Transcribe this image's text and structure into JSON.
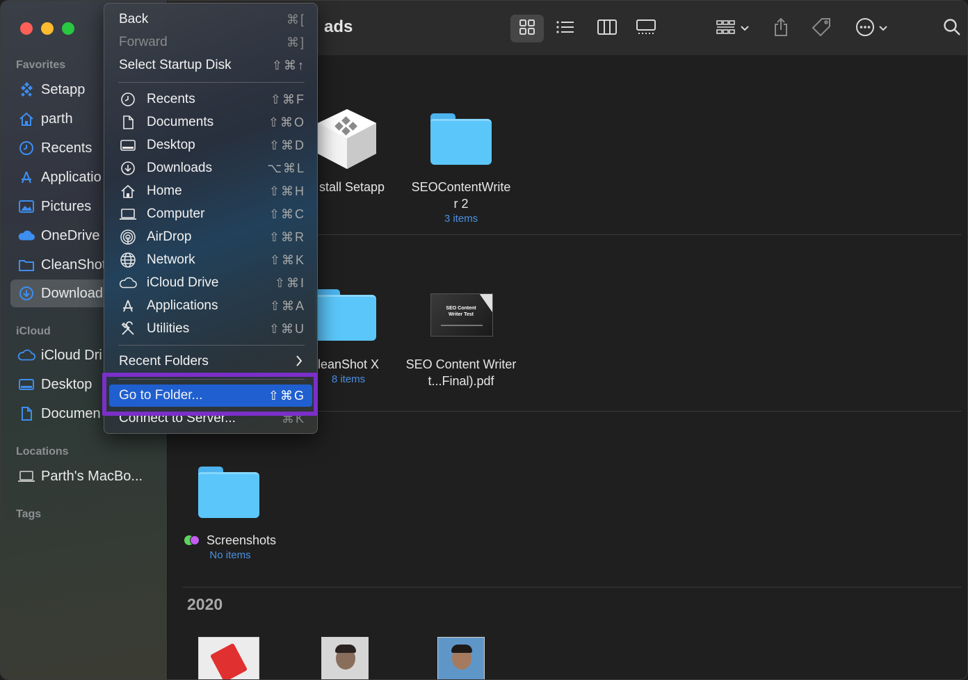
{
  "window": {
    "title_partial": "ads"
  },
  "sidebar": {
    "favorites_title": "Favorites",
    "favorites": [
      {
        "label": "Setapp",
        "icon": "setapp-icon"
      },
      {
        "label": "parth",
        "icon": "home-icon"
      },
      {
        "label": "Recents",
        "icon": "clock-icon"
      },
      {
        "label": "Applicatio",
        "icon": "applications-icon"
      },
      {
        "label": "Pictures",
        "icon": "pictures-icon"
      },
      {
        "label": "OneDrive",
        "icon": "cloud-icon"
      },
      {
        "label": "CleanShot",
        "icon": "folder-icon"
      },
      {
        "label": "Download",
        "icon": "download-icon",
        "active": true
      }
    ],
    "icloud_title": "iCloud",
    "icloud": [
      {
        "label": "iCloud Dri",
        "icon": "icloud-icon"
      },
      {
        "label": "Desktop",
        "icon": "desktop-icon"
      },
      {
        "label": "Documen",
        "icon": "document-icon"
      }
    ],
    "locations_title": "Locations",
    "locations": [
      {
        "label": "Parth's MacBo...",
        "icon": "laptop-icon"
      }
    ],
    "tags_title": "Tags"
  },
  "menu": {
    "back": {
      "label": "Back",
      "shortcut": "⌘["
    },
    "forward": {
      "label": "Forward",
      "shortcut": "⌘]"
    },
    "startup": {
      "label": "Select Startup Disk",
      "shortcut": "⇧⌘↑"
    },
    "places": [
      {
        "label": "Recents",
        "shortcut": "⇧⌘F",
        "icon": "clock-icon"
      },
      {
        "label": "Documents",
        "shortcut": "⇧⌘O",
        "icon": "document-icon"
      },
      {
        "label": "Desktop",
        "shortcut": "⇧⌘D",
        "icon": "desktop-icon"
      },
      {
        "label": "Downloads",
        "shortcut": "⌥⌘L",
        "icon": "download-icon"
      },
      {
        "label": "Home",
        "shortcut": "⇧⌘H",
        "icon": "home-icon"
      },
      {
        "label": "Computer",
        "shortcut": "⇧⌘C",
        "icon": "laptop-icon"
      },
      {
        "label": "AirDrop",
        "shortcut": "⇧⌘R",
        "icon": "airdrop-icon"
      },
      {
        "label": "Network",
        "shortcut": "⇧⌘K",
        "icon": "globe-icon"
      },
      {
        "label": "iCloud Drive",
        "shortcut": "⇧⌘I",
        "icon": "icloud-icon"
      },
      {
        "label": "Applications",
        "shortcut": "⇧⌘A",
        "icon": "applications-icon"
      },
      {
        "label": "Utilities",
        "shortcut": "⇧⌘U",
        "icon": "tools-icon"
      }
    ],
    "recent_folders": {
      "label": "Recent Folders"
    },
    "go_to_folder": {
      "label": "Go to Folder...",
      "shortcut": "⇧⌘G"
    },
    "connect": {
      "label": "Connect to Server...",
      "shortcut": "⌘K"
    }
  },
  "content": {
    "items": [
      {
        "name": "stall Setapp",
        "sub": ""
      },
      {
        "name": "SEOContentWrite r 2",
        "sub": "3 items"
      },
      {
        "name": "leanShot X",
        "sub": "8 items"
      },
      {
        "name": "SEO Content Writer t...Final).pdf",
        "sub": ""
      },
      {
        "name": "Screenshots",
        "sub": "No items"
      }
    ],
    "pdf_thumb_text": "SEO Content Writer Test",
    "year_header": "2020"
  },
  "colors": {
    "folder": "#5bc6fa",
    "highlight": "#1f5fd0",
    "annotation": "#7b2fc9",
    "link": "#4a90e2"
  }
}
